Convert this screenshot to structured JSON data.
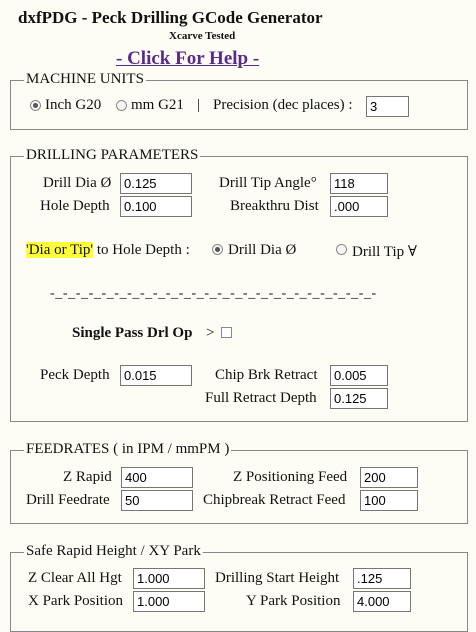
{
  "header": {
    "title": "dxfPDG  -  Peck Drilling GCode Generator",
    "subtitle": "Xcarve Tested",
    "help_link": "- Click For Help -"
  },
  "machine_units": {
    "legend": "MACHINE UNITS",
    "inch_label": "Inch G20",
    "inch_checked": true,
    "mm_label": "mm G21",
    "separator": "|",
    "precision_label": "Precision (dec places) :",
    "precision_value": "3"
  },
  "drilling": {
    "legend": "DRILLING PARAMETERS",
    "drill_dia_label": "Drill Dia Ø",
    "drill_dia_value": "0.125",
    "tip_angle_label": "Drill Tip Angle°",
    "tip_angle_value": "118",
    "hole_depth_label": "Hole Depth",
    "hole_depth_value": "0.100",
    "breakthru_label": "Breakthru Dist",
    "breakthru_value": ".000",
    "dia_or_tip_highlight": "'Dia or Tip'",
    "dia_or_tip_rest": " to Hole Depth :",
    "opt_dia_label": "Drill Dia Ø",
    "opt_dia_checked": true,
    "opt_tip_label": "Drill Tip ∀",
    "divider": "-_-_-_-_-_-_-_-_-_-_-_-_-_-_-_-_-_-_-_-_-_-_-_-_-_-",
    "single_pass_label": "Single Pass Drl Op",
    "single_pass_arrow": ">",
    "peck_depth_label": "Peck Depth",
    "peck_depth_value": "0.015",
    "chip_retract_label": "Chip Brk Retract",
    "chip_retract_value": "0.005",
    "full_retract_label": "Full Retract Depth",
    "full_retract_value": "0.125"
  },
  "feedrates": {
    "legend": "FEEDRATES ( in IPM / mmPM )",
    "z_rapid_label": "Z Rapid",
    "z_rapid_value": "400",
    "z_pos_label": "Z Positioning Feed",
    "z_pos_value": "200",
    "drill_feed_label": "Drill Feedrate",
    "drill_feed_value": "50",
    "chipbreak_label": "Chipbreak Retract Feed",
    "chipbreak_value": "100"
  },
  "safe": {
    "legend": "Safe Rapid Height / XY Park",
    "z_clear_label": "Z Clear All Hgt",
    "z_clear_value": "1.000",
    "start_height_label": "Drilling Start Height",
    "start_height_value": ".125",
    "x_park_label": "X Park Position",
    "x_park_value": "1.000",
    "y_park_label": "Y Park Position",
    "y_park_value": "4.000"
  }
}
